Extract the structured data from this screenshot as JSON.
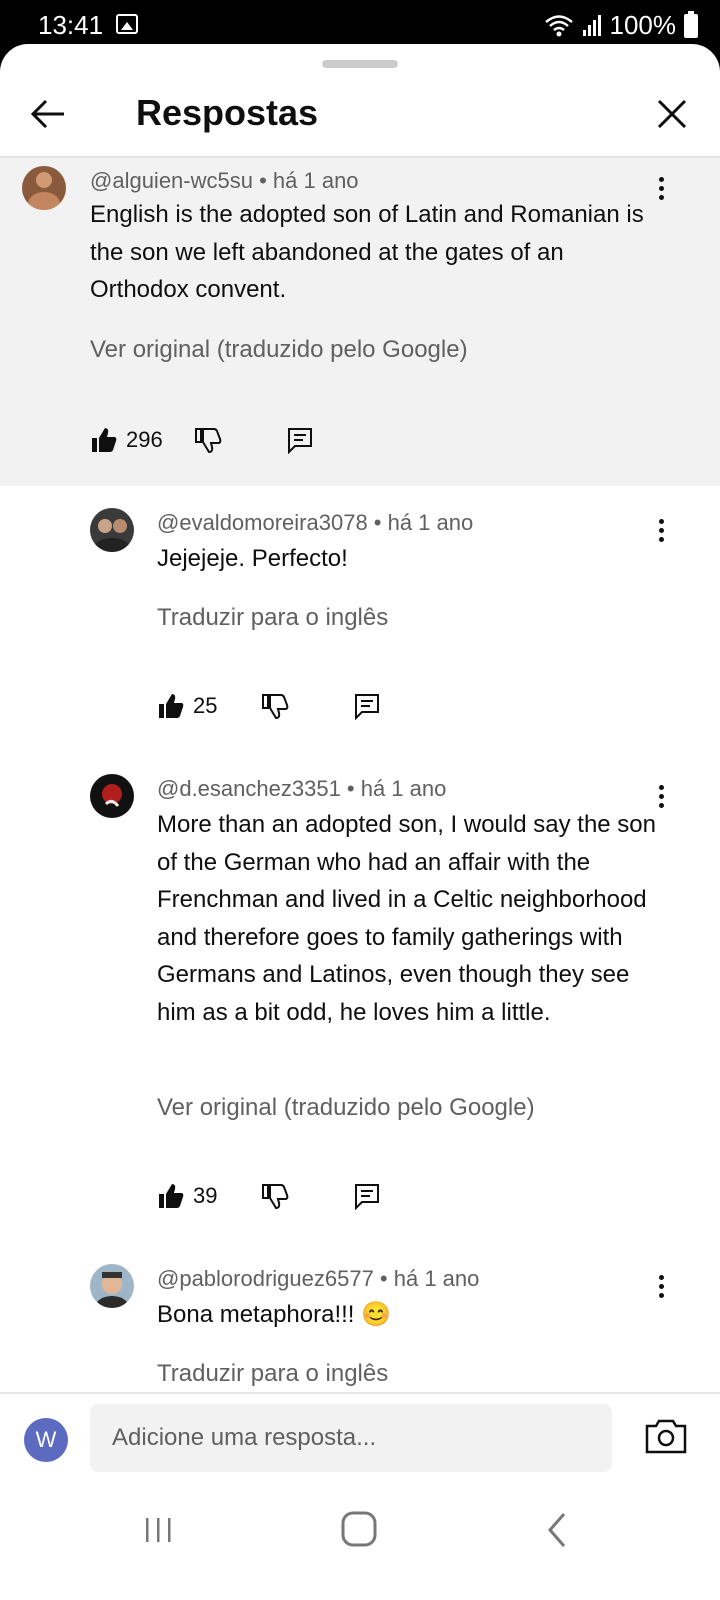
{
  "status_bar": {
    "time": "13:41",
    "icons": [
      "gallery-icon",
      "wifi-icon",
      "signal-icon",
      "battery-icon"
    ],
    "battery": "100%"
  },
  "header": {
    "title": "Respostas",
    "back_icon": "arrow-left-icon",
    "close_icon": "close-icon"
  },
  "comments": [
    {
      "author": "@alguien-wc5su",
      "time": "há 1 ano",
      "meta": "@alguien-wc5su • há 1 ano",
      "text": "English is the adopted son of Latin and Romanian is the son we left abandoned at the gates of an Orthodox convent.",
      "translate_link": "Ver original (traduzido pelo Google)",
      "likes": "296",
      "highlighted": true,
      "avatar_color": "#8a5a3c"
    },
    {
      "author": "@evaldomoreira3078",
      "time": "há 1 ano",
      "meta": "@evaldomoreira3078 • há 1 ano",
      "text": "Jejejeje. Perfecto!",
      "translate_link": "Traduzir para o inglês",
      "likes": "25",
      "avatar_color": "#3a3a3a"
    },
    {
      "author": "@d.esanchez3351",
      "time": "há 1 ano",
      "meta": "@d.esanchez3351 • há 1 ano",
      "text": "More than an adopted son, I would say the son of the German who had an affair with the Frenchman and lived in a Celtic neighborhood and therefore goes to family gatherings with Germans and Latinos, even though they see him as a bit odd, he loves him a little.",
      "translate_link": "Ver original (traduzido pelo Google)",
      "likes": "39",
      "avatar_color": "#111111"
    },
    {
      "author": "@pablorodriguez6577",
      "time": "há 1 ano",
      "meta": "@pablorodriguez6577 • há 1 ano",
      "text": "Bona metaphora!!! 😊",
      "translate_link": "Traduzir para o inglês",
      "avatar_color": "#9fb6c8"
    }
  ],
  "reply_bar": {
    "user_initial": "W",
    "placeholder": "Adicione uma resposta...",
    "camera_icon": "camera-icon"
  },
  "nav_bar": {
    "icons": [
      "recents-icon",
      "home-icon",
      "back-icon"
    ]
  }
}
